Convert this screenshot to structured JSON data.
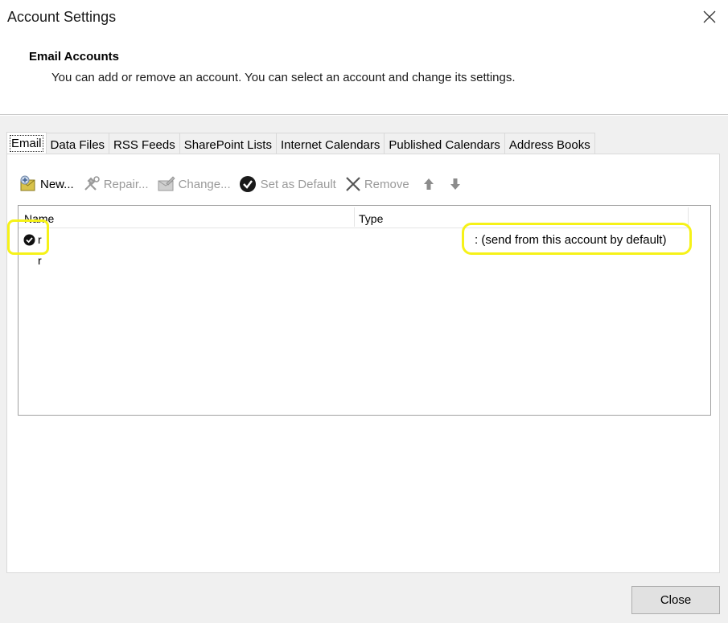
{
  "window": {
    "title": "Account Settings"
  },
  "header": {
    "title": "Email Accounts",
    "subtitle": "You can add or remove an account. You can select an account and change its settings."
  },
  "tabs": [
    {
      "label": "Email",
      "active": true
    },
    {
      "label": "Data Files"
    },
    {
      "label": "RSS Feeds"
    },
    {
      "label": "SharePoint Lists"
    },
    {
      "label": "Internet Calendars"
    },
    {
      "label": "Published Calendars"
    },
    {
      "label": "Address Books"
    }
  ],
  "toolbar": {
    "new_label": "New...",
    "repair_label": "Repair...",
    "change_label": "Change...",
    "default_label": "Set as Default",
    "remove_label": "Remove"
  },
  "list": {
    "col_name": "Name",
    "col_type": "Type",
    "rows": [
      {
        "name": "r",
        "type": ": (send from this account by default)",
        "is_default": true
      },
      {
        "name": "r",
        "type": ""
      }
    ]
  },
  "footer": {
    "close_label": "Close"
  },
  "colors": {
    "highlight": "#f6f218"
  }
}
